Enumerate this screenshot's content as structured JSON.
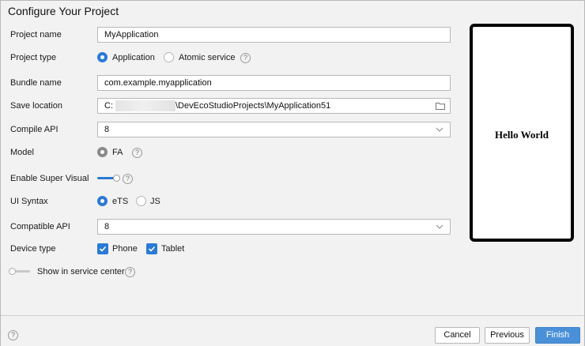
{
  "dialog": {
    "title": "Configure Your Project"
  },
  "project_name": {
    "label": "Project name",
    "value": "MyApplication"
  },
  "project_type": {
    "label": "Project type",
    "options": [
      "Application",
      "Atomic service"
    ],
    "selected": "Application"
  },
  "bundle_name": {
    "label": "Bundle name",
    "value": "com.example.myapplication"
  },
  "save_location": {
    "label": "Save location",
    "prefix": "C:",
    "path": "\\DevEcoStudioProjects\\MyApplication51"
  },
  "compile_api": {
    "label": "Compile API",
    "value": "8"
  },
  "model": {
    "label": "Model",
    "option": "FA"
  },
  "super_visual": {
    "label": "Enable Super Visual",
    "enabled": true
  },
  "ui_syntax": {
    "label": "UI Syntax",
    "options": [
      "eTS",
      "JS"
    ],
    "selected": "eTS"
  },
  "compatible_api": {
    "label": "Compatible API",
    "value": "8"
  },
  "device_type": {
    "label": "Device type",
    "options": [
      "Phone",
      "Tablet"
    ],
    "checked": [
      "Phone",
      "Tablet"
    ]
  },
  "service_center": {
    "label": "Show in service center",
    "enabled": false
  },
  "preview": {
    "text": "Hello World"
  },
  "help_glyph": "?",
  "footer": {
    "cancel": "Cancel",
    "previous": "Previous",
    "finish": "Finish"
  },
  "colors": {
    "accent": "#2a7ad6",
    "finish_button": "#4a90d9"
  }
}
